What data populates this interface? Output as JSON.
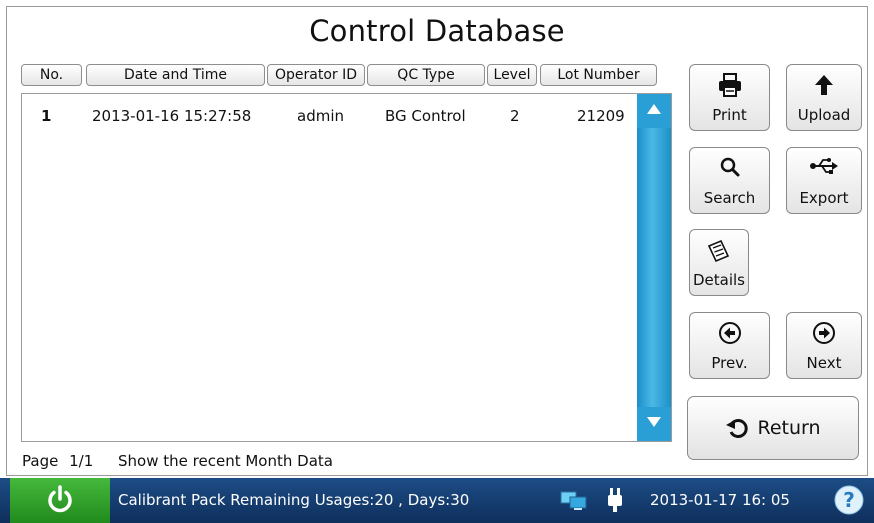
{
  "title": "Control Database",
  "table": {
    "headers": [
      "No.",
      "Date and Time",
      "Operator ID",
      "QC Type",
      "Level",
      "Lot Number"
    ],
    "rows": [
      [
        "1",
        "2013-01-16 15:27:58",
        "admin",
        "BG Control",
        "2",
        "21209"
      ]
    ]
  },
  "buttons": {
    "print": "Print",
    "upload": "Upload",
    "search": "Search",
    "export": "Export",
    "details": "Details",
    "prev": "Prev.",
    "next": "Next",
    "return": "Return"
  },
  "footer": {
    "page_label": "Page",
    "page_value": "1/1",
    "range_text": "Show the recent Month Data"
  },
  "statusbar": {
    "message": "Calibrant Pack Remaining Usages:20 , Days:30",
    "datetime": "2013-01-17  16: 05"
  },
  "icons": [
    "power-icon",
    "printer-icon",
    "upload-arrow-icon",
    "search-icon",
    "usb-icon",
    "details-icon",
    "prev-arrow-icon",
    "next-arrow-icon",
    "return-icon",
    "network-icon",
    "plug-icon",
    "help-icon"
  ],
  "colors": {
    "scrollbar": "#2a9fd6",
    "statusbar": "#123a6b",
    "power": "#2f9e2a"
  }
}
